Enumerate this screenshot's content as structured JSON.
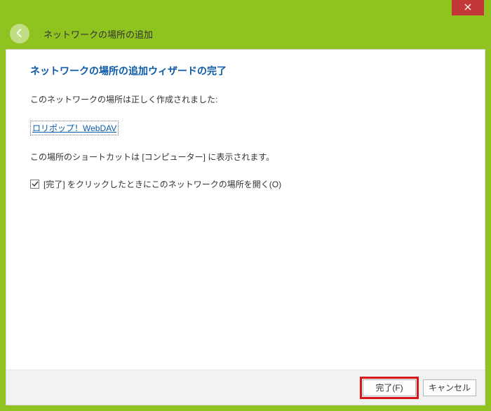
{
  "window": {
    "title": "ネットワークの場所の追加"
  },
  "wizard": {
    "heading": "ネットワークの場所の追加ウィザードの完了",
    "created_msg": "このネットワークの場所は正しく作成されました:",
    "location_link": "ロリポップ！WebDAV",
    "shortcut_msg": "この場所のショートカットは [コンピューター] に表示されます。",
    "open_checkbox_label": "[完了] をクリックしたときにこのネットワークの場所を開く(O)",
    "open_checked": true
  },
  "buttons": {
    "finish": "完了(F)",
    "cancel": "キャンセル"
  }
}
